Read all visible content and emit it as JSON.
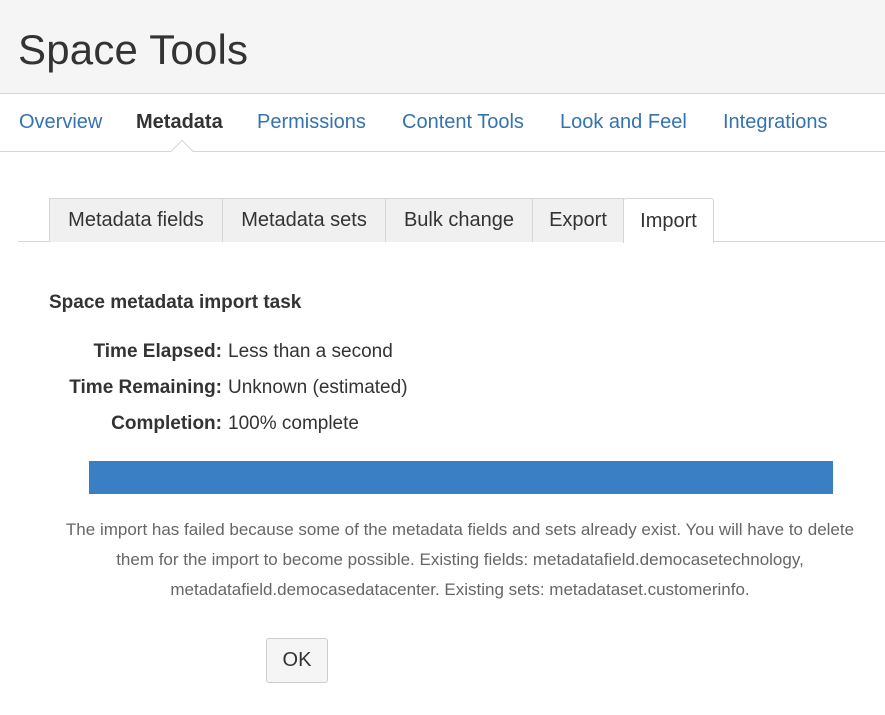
{
  "header": {
    "title": "Space Tools"
  },
  "nav": {
    "items": [
      {
        "label": "Overview"
      },
      {
        "label": "Metadata"
      },
      {
        "label": "Permissions"
      },
      {
        "label": "Content Tools"
      },
      {
        "label": "Look and Feel"
      },
      {
        "label": "Integrations"
      }
    ],
    "active": "Metadata"
  },
  "tabs": {
    "items": [
      {
        "label": "Metadata fields"
      },
      {
        "label": "Metadata sets"
      },
      {
        "label": "Bulk change"
      },
      {
        "label": "Export"
      },
      {
        "label": "Import"
      }
    ],
    "active": "Import"
  },
  "task": {
    "title": "Space metadata import task",
    "time_elapsed_label": "Time Elapsed:",
    "time_elapsed_value": "Less than a second",
    "time_remaining_label": "Time Remaining:",
    "time_remaining_value": "Unknown (estimated)",
    "completion_label": "Completion:",
    "completion_value": "100% complete",
    "progress_percent": 100,
    "message": "The import has failed because some of the metadata fields and sets already exist. You will have to delete them for the import to become possible. Existing fields: metadatafield.democasetechnology, metadatafield.democasedatacenter. Existing sets: metadataset.customerinfo.",
    "ok_label": "OK"
  },
  "colors": {
    "link": "#3572b0",
    "progress": "#3a7fc4",
    "header_bg": "#f5f5f5"
  }
}
